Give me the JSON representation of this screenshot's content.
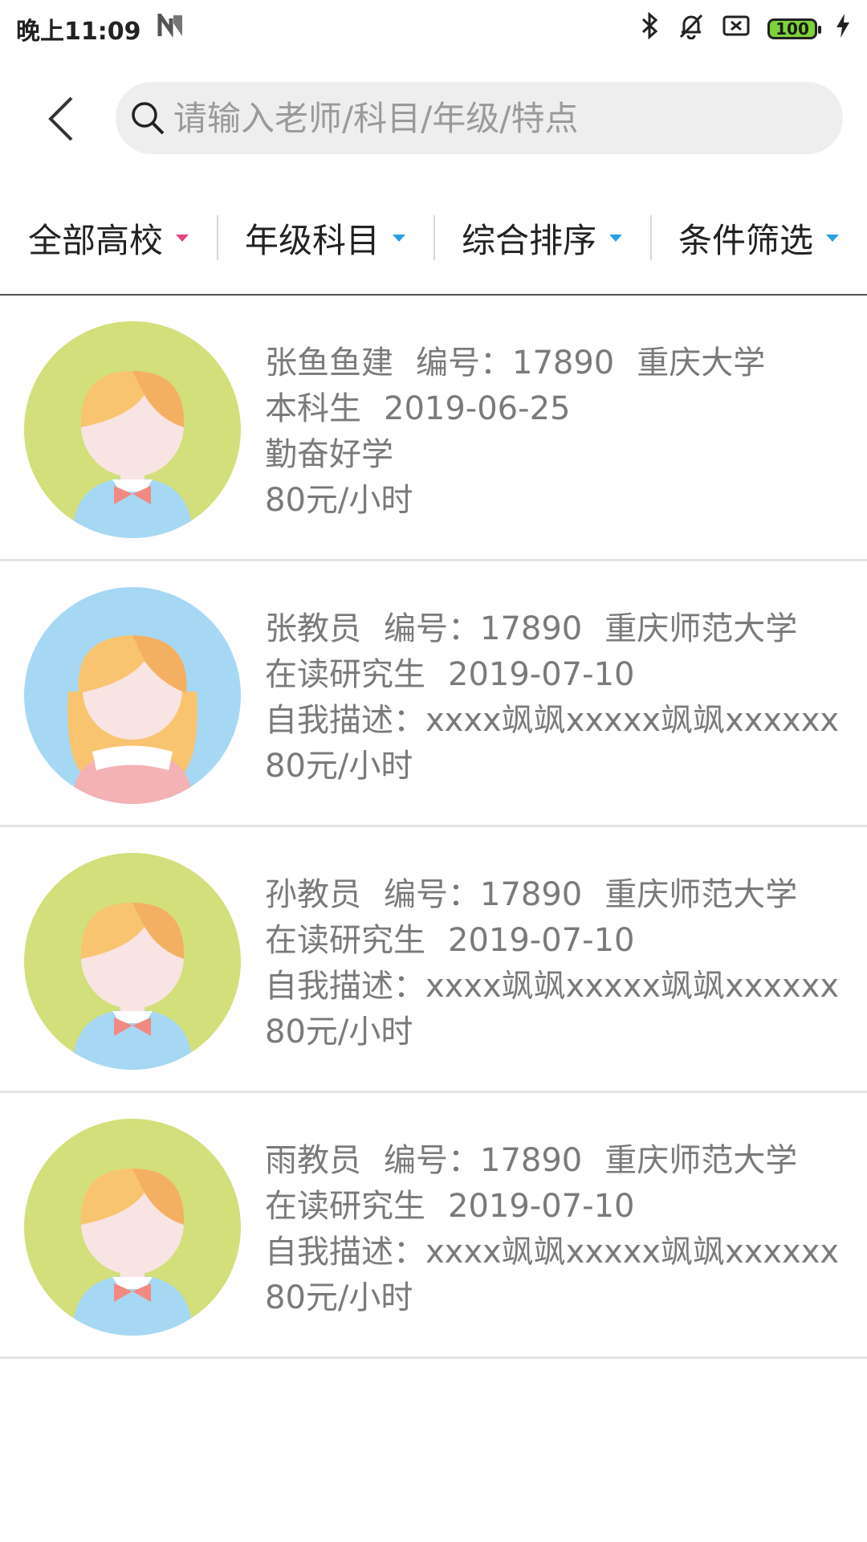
{
  "status_bar": {
    "time": "晚上11:09",
    "battery": "100",
    "icons": [
      "n-icon",
      "bluetooth-icon",
      "mute-bell-icon",
      "sim-x-icon",
      "battery-icon",
      "charging-icon"
    ]
  },
  "search": {
    "placeholder": "请输入老师/科目/年级/特点",
    "value": ""
  },
  "filters": [
    {
      "label": "全部高校",
      "color": "#e6457a"
    },
    {
      "label": "年级科目",
      "color": "#2b9fe6"
    },
    {
      "label": "综合排序",
      "color": "#2b9fe6"
    },
    {
      "label": "条件筛选",
      "color": "#2b9fe6"
    }
  ],
  "teachers": [
    {
      "name": "张鱼鱼建",
      "id": "编号：17890",
      "school": "重庆大学",
      "level": "本科生",
      "date": "2019-06-25",
      "desc": "勤奋好学",
      "price": "80元/小时",
      "avatar": "boy-avatar-green"
    },
    {
      "name": "张教员",
      "id": "编号：17890",
      "school": "重庆师范大学",
      "level": "在读研究生",
      "date": "2019-07-10",
      "desc": "自我描述：xxxx飒飒xxxxx飒飒xxxxxx",
      "price": "80元/小时",
      "avatar": "girl-avatar-blue"
    },
    {
      "name": "孙教员",
      "id": "编号：17890",
      "school": "重庆师范大学",
      "level": "在读研究生",
      "date": "2019-07-10",
      "desc": "自我描述：xxxx飒飒xxxxx飒飒xxxxxx",
      "price": "80元/小时",
      "avatar": "boy-avatar-green"
    },
    {
      "name": "雨教员",
      "id": "编号：17890",
      "school": "重庆师范大学",
      "level": "在读研究生",
      "date": "2019-07-10",
      "desc": "自我描述：xxxx飒飒xxxxx飒飒xxxxxx",
      "price": "80元/小时",
      "avatar": "boy-avatar-green"
    }
  ]
}
